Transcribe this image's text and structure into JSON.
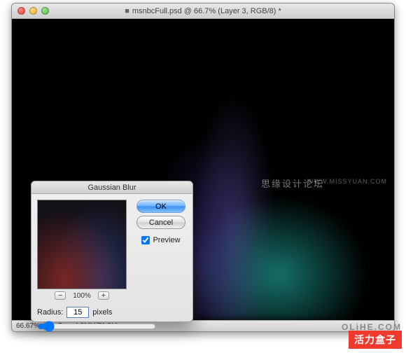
{
  "window": {
    "title": "msnbcFull.psd @ 66.7% (Layer 3, RGB/8) *",
    "unsaved_marker": "■"
  },
  "status": {
    "zoom": "66.67%",
    "doc": "Doc: 4.9MM/71.3M"
  },
  "dialog": {
    "title": "Gaussian Blur",
    "ok": "OK",
    "cancel": "Cancel",
    "preview_label": "Preview",
    "preview_checked": true,
    "zoom_out": "−",
    "zoom_pct": "100%",
    "zoom_in": "+",
    "radius_label": "Radius:",
    "radius_value": "15",
    "radius_unit": "pixels",
    "slider_min": 0,
    "slider_max": 250,
    "slider_value": 15
  },
  "watermarks": {
    "cn": "思缘设计论坛",
    "url": "WWW.MISSYUAN.COM",
    "brand": "活力盒子",
    "olihe": "OLiHE.COM"
  }
}
